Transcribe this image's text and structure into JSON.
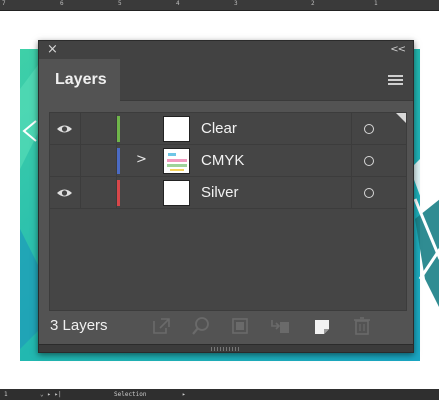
{
  "ruler": {
    "ticks": [
      "7",
      "6",
      "5",
      "4",
      "3",
      "2",
      "1"
    ]
  },
  "panel": {
    "close_symbol": "×",
    "collapse_symbol": "<<",
    "tab_label": "Layers",
    "menu_icon": "panel-menu-icon",
    "layers": [
      {
        "name": "Clear",
        "visible": true,
        "expandable": false,
        "color": "#6fb54a",
        "thumbnail": "blank",
        "selected_corner": true
      },
      {
        "name": "CMYK",
        "visible": false,
        "expandable": true,
        "color": "#4b6bc4",
        "thumbnail": "artwork",
        "selected_corner": false
      },
      {
        "name": "Silver",
        "visible": true,
        "expandable": false,
        "color": "#d8474a",
        "thumbnail": "blank",
        "selected_corner": false
      }
    ],
    "expand_symbol": ">",
    "footer": {
      "count_label": "3 Layers",
      "buttons": [
        "export-for-screens-icon",
        "locate-object-icon",
        "make-clipping-mask-icon",
        "create-sublayer-icon",
        "create-new-layer-icon",
        "delete-layer-icon"
      ]
    }
  },
  "statusbar": {
    "zoom": "1",
    "tool": "Selection",
    "arrows": "⌄ ▸ ▸|",
    "play": "▸"
  },
  "colors": {
    "panel_bg": "#535353",
    "list_bg": "#454545",
    "art_teal": "#2ec3a8"
  }
}
